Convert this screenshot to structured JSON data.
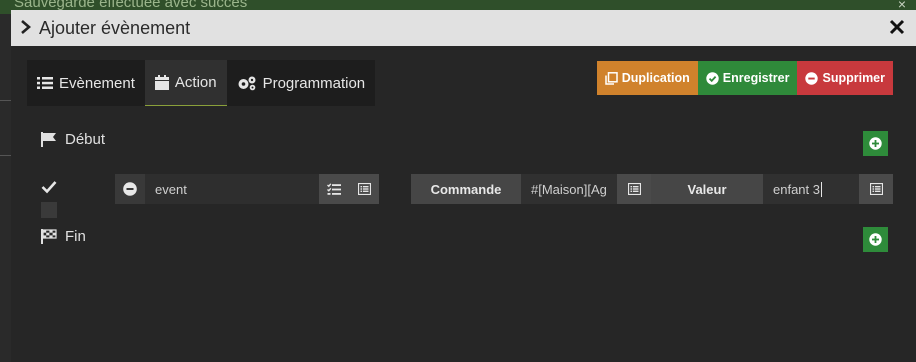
{
  "background": {
    "toast_text": "Sauvegarde effectuée avec succès",
    "toast_close": "×"
  },
  "modal": {
    "title": "Ajouter évènement",
    "close_label": "×"
  },
  "tabs": [
    {
      "label": "Evènement",
      "icon": "list-icon"
    },
    {
      "label": "Action",
      "icon": "calendar-icon"
    },
    {
      "label": "Programmation",
      "icon": "gears-icon"
    }
  ],
  "actions": {
    "duplicate": "Duplication",
    "save": "Enregistrer",
    "delete": "Supprimer"
  },
  "sections": {
    "start": "Début",
    "end": "Fin"
  },
  "action_row": {
    "event_value": "event",
    "command_label": "Commande",
    "command_value": "#[Maison][Ag",
    "value_label": "Valeur",
    "value_value": "enfant 3"
  },
  "colors": {
    "duplicate": "#d0822c",
    "save": "#2f8a3a",
    "delete": "#c8393d",
    "add": "#2e8b3a",
    "active_tab_underline": "#8aa03a"
  }
}
